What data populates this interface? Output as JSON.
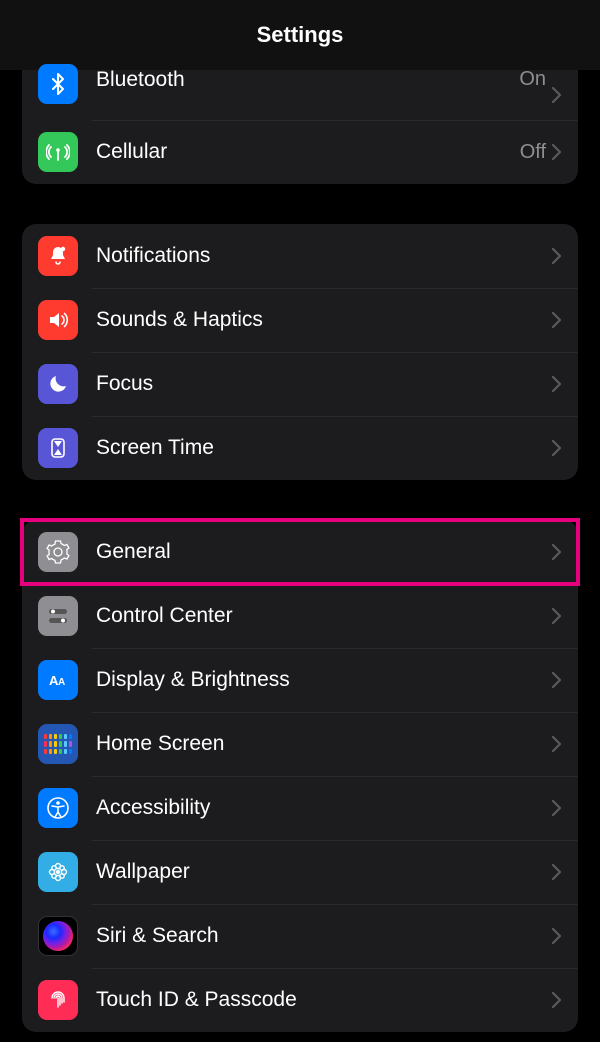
{
  "header": {
    "title": "Settings"
  },
  "groups": [
    {
      "id": "connectivity",
      "items": [
        {
          "id": "bluetooth",
          "label": "Bluetooth",
          "value": "On",
          "icon": "bluetooth-icon",
          "bg": "bg-blue",
          "partial": true
        },
        {
          "id": "cellular",
          "label": "Cellular",
          "value": "Off",
          "icon": "antenna-icon",
          "bg": "bg-green"
        }
      ]
    },
    {
      "id": "alerts",
      "items": [
        {
          "id": "notifications",
          "label": "Notifications",
          "icon": "bell-icon",
          "bg": "bg-red"
        },
        {
          "id": "sounds",
          "label": "Sounds & Haptics",
          "icon": "speaker-icon",
          "bg": "bg-red2"
        },
        {
          "id": "focus",
          "label": "Focus",
          "icon": "moon-icon",
          "bg": "bg-indigo"
        },
        {
          "id": "screentime",
          "label": "Screen Time",
          "icon": "hourglass-icon",
          "bg": "bg-indigo"
        }
      ]
    },
    {
      "id": "system",
      "items": [
        {
          "id": "general",
          "label": "General",
          "icon": "gear-icon",
          "bg": "bg-gray",
          "highlight": true
        },
        {
          "id": "controlcenter",
          "label": "Control Center",
          "icon": "toggles-icon",
          "bg": "bg-gray"
        },
        {
          "id": "display",
          "label": "Display & Brightness",
          "icon": "aa-icon",
          "bg": "bg-blue"
        },
        {
          "id": "homescreen",
          "label": "Home Screen",
          "icon": "appgrid-icon",
          "bg": "bg-appgrid"
        },
        {
          "id": "accessibility",
          "label": "Accessibility",
          "icon": "accessibility-icon",
          "bg": "bg-blue"
        },
        {
          "id": "wallpaper",
          "label": "Wallpaper",
          "icon": "flower-icon",
          "bg": "bg-cyan"
        },
        {
          "id": "siri",
          "label": "Siri & Search",
          "icon": "siri-icon",
          "bg": "bg-black"
        },
        {
          "id": "touchid",
          "label": "Touch ID & Passcode",
          "icon": "fingerprint-icon",
          "bg": "bg-pink"
        }
      ]
    }
  ],
  "appgrid_colors": [
    "#ff3b30",
    "#ff9500",
    "#ffcc00",
    "#34c759",
    "#5ac8fa",
    "#007aff",
    "#ff2d55",
    "#ff9500",
    "#ffcc00",
    "#34c759",
    "#5ac8fa",
    "#af52de",
    "#ff3b30",
    "#ff9500",
    "#ffcc00",
    "#34c759",
    "#5ac8fa",
    "#007aff"
  ]
}
